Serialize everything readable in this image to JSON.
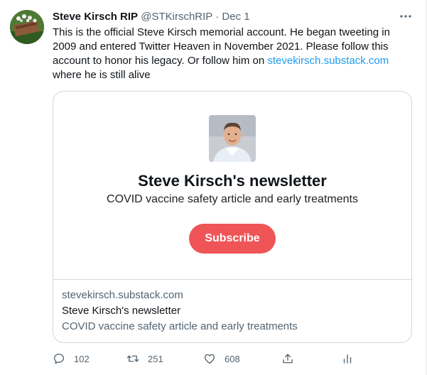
{
  "tweet": {
    "author_name": "Steve Kirsch RIP",
    "handle": "@STKirschRIP",
    "separator": "·",
    "date": "Dec 1",
    "more_icon": "more-horizontal-icon",
    "text_before_link": "This is the official Steve Kirsch memorial account. He began tweeting in 2009 and entered Twitter Heaven in November 2021. Please follow this account to honor his legacy. Or follow him on ",
    "link": "stevekirsch.substack.com",
    "text_after_link": " where he is still alive",
    "link_color": "#1d9bf0"
  },
  "card": {
    "newsletter_title": "Steve Kirsch's newsletter",
    "newsletter_subtitle": "COVID vaccine safety article and early treatments",
    "subscribe_label": "Subscribe",
    "subscribe_color": "#ef5457",
    "domain": "stevekirsch.substack.com",
    "title": "Steve Kirsch's newsletter",
    "description": "COVID vaccine safety article and early treatments"
  },
  "actions": {
    "reply": {
      "icon": "reply-icon",
      "count": "102"
    },
    "retweet": {
      "icon": "retweet-icon",
      "count": "251"
    },
    "like": {
      "icon": "heart-icon",
      "count": "608"
    },
    "share": {
      "icon": "share-icon"
    },
    "analytics": {
      "icon": "analytics-icon"
    }
  }
}
